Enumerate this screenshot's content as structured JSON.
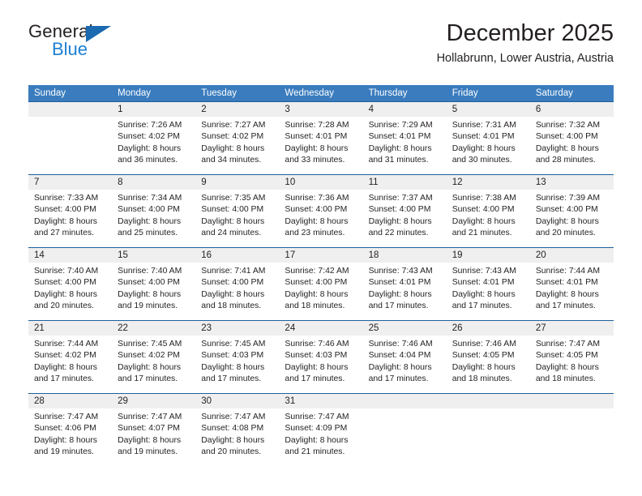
{
  "brand": {
    "name_part1": "General",
    "name_part2": "Blue",
    "triangle_color": "#1b69b0",
    "accent_color": "#1b7fd4"
  },
  "header": {
    "title": "December 2025",
    "subtitle": "Hollabrunn, Lower Austria, Austria"
  },
  "theme": {
    "header_bg": "#3a7cbe",
    "week_divider": "#1f6099",
    "daynum_bg": "#efefef",
    "text": "#231f20"
  },
  "weekdays": [
    "Sunday",
    "Monday",
    "Tuesday",
    "Wednesday",
    "Thursday",
    "Friday",
    "Saturday"
  ],
  "weeks": [
    [
      {
        "day": "",
        "sunrise": "",
        "sunset": "",
        "daylight_line1": "",
        "daylight_line2": ""
      },
      {
        "day": "1",
        "sunrise": "Sunrise: 7:26 AM",
        "sunset": "Sunset: 4:02 PM",
        "daylight_line1": "Daylight: 8 hours",
        "daylight_line2": "and 36 minutes."
      },
      {
        "day": "2",
        "sunrise": "Sunrise: 7:27 AM",
        "sunset": "Sunset: 4:02 PM",
        "daylight_line1": "Daylight: 8 hours",
        "daylight_line2": "and 34 minutes."
      },
      {
        "day": "3",
        "sunrise": "Sunrise: 7:28 AM",
        "sunset": "Sunset: 4:01 PM",
        "daylight_line1": "Daylight: 8 hours",
        "daylight_line2": "and 33 minutes."
      },
      {
        "day": "4",
        "sunrise": "Sunrise: 7:29 AM",
        "sunset": "Sunset: 4:01 PM",
        "daylight_line1": "Daylight: 8 hours",
        "daylight_line2": "and 31 minutes."
      },
      {
        "day": "5",
        "sunrise": "Sunrise: 7:31 AM",
        "sunset": "Sunset: 4:01 PM",
        "daylight_line1": "Daylight: 8 hours",
        "daylight_line2": "and 30 minutes."
      },
      {
        "day": "6",
        "sunrise": "Sunrise: 7:32 AM",
        "sunset": "Sunset: 4:00 PM",
        "daylight_line1": "Daylight: 8 hours",
        "daylight_line2": "and 28 minutes."
      }
    ],
    [
      {
        "day": "7",
        "sunrise": "Sunrise: 7:33 AM",
        "sunset": "Sunset: 4:00 PM",
        "daylight_line1": "Daylight: 8 hours",
        "daylight_line2": "and 27 minutes."
      },
      {
        "day": "8",
        "sunrise": "Sunrise: 7:34 AM",
        "sunset": "Sunset: 4:00 PM",
        "daylight_line1": "Daylight: 8 hours",
        "daylight_line2": "and 25 minutes."
      },
      {
        "day": "9",
        "sunrise": "Sunrise: 7:35 AM",
        "sunset": "Sunset: 4:00 PM",
        "daylight_line1": "Daylight: 8 hours",
        "daylight_line2": "and 24 minutes."
      },
      {
        "day": "10",
        "sunrise": "Sunrise: 7:36 AM",
        "sunset": "Sunset: 4:00 PM",
        "daylight_line1": "Daylight: 8 hours",
        "daylight_line2": "and 23 minutes."
      },
      {
        "day": "11",
        "sunrise": "Sunrise: 7:37 AM",
        "sunset": "Sunset: 4:00 PM",
        "daylight_line1": "Daylight: 8 hours",
        "daylight_line2": "and 22 minutes."
      },
      {
        "day": "12",
        "sunrise": "Sunrise: 7:38 AM",
        "sunset": "Sunset: 4:00 PM",
        "daylight_line1": "Daylight: 8 hours",
        "daylight_line2": "and 21 minutes."
      },
      {
        "day": "13",
        "sunrise": "Sunrise: 7:39 AM",
        "sunset": "Sunset: 4:00 PM",
        "daylight_line1": "Daylight: 8 hours",
        "daylight_line2": "and 20 minutes."
      }
    ],
    [
      {
        "day": "14",
        "sunrise": "Sunrise: 7:40 AM",
        "sunset": "Sunset: 4:00 PM",
        "daylight_line1": "Daylight: 8 hours",
        "daylight_line2": "and 20 minutes."
      },
      {
        "day": "15",
        "sunrise": "Sunrise: 7:40 AM",
        "sunset": "Sunset: 4:00 PM",
        "daylight_line1": "Daylight: 8 hours",
        "daylight_line2": "and 19 minutes."
      },
      {
        "day": "16",
        "sunrise": "Sunrise: 7:41 AM",
        "sunset": "Sunset: 4:00 PM",
        "daylight_line1": "Daylight: 8 hours",
        "daylight_line2": "and 18 minutes."
      },
      {
        "day": "17",
        "sunrise": "Sunrise: 7:42 AM",
        "sunset": "Sunset: 4:00 PM",
        "daylight_line1": "Daylight: 8 hours",
        "daylight_line2": "and 18 minutes."
      },
      {
        "day": "18",
        "sunrise": "Sunrise: 7:43 AM",
        "sunset": "Sunset: 4:01 PM",
        "daylight_line1": "Daylight: 8 hours",
        "daylight_line2": "and 17 minutes."
      },
      {
        "day": "19",
        "sunrise": "Sunrise: 7:43 AM",
        "sunset": "Sunset: 4:01 PM",
        "daylight_line1": "Daylight: 8 hours",
        "daylight_line2": "and 17 minutes."
      },
      {
        "day": "20",
        "sunrise": "Sunrise: 7:44 AM",
        "sunset": "Sunset: 4:01 PM",
        "daylight_line1": "Daylight: 8 hours",
        "daylight_line2": "and 17 minutes."
      }
    ],
    [
      {
        "day": "21",
        "sunrise": "Sunrise: 7:44 AM",
        "sunset": "Sunset: 4:02 PM",
        "daylight_line1": "Daylight: 8 hours",
        "daylight_line2": "and 17 minutes."
      },
      {
        "day": "22",
        "sunrise": "Sunrise: 7:45 AM",
        "sunset": "Sunset: 4:02 PM",
        "daylight_line1": "Daylight: 8 hours",
        "daylight_line2": "and 17 minutes."
      },
      {
        "day": "23",
        "sunrise": "Sunrise: 7:45 AM",
        "sunset": "Sunset: 4:03 PM",
        "daylight_line1": "Daylight: 8 hours",
        "daylight_line2": "and 17 minutes."
      },
      {
        "day": "24",
        "sunrise": "Sunrise: 7:46 AM",
        "sunset": "Sunset: 4:03 PM",
        "daylight_line1": "Daylight: 8 hours",
        "daylight_line2": "and 17 minutes."
      },
      {
        "day": "25",
        "sunrise": "Sunrise: 7:46 AM",
        "sunset": "Sunset: 4:04 PM",
        "daylight_line1": "Daylight: 8 hours",
        "daylight_line2": "and 17 minutes."
      },
      {
        "day": "26",
        "sunrise": "Sunrise: 7:46 AM",
        "sunset": "Sunset: 4:05 PM",
        "daylight_line1": "Daylight: 8 hours",
        "daylight_line2": "and 18 minutes."
      },
      {
        "day": "27",
        "sunrise": "Sunrise: 7:47 AM",
        "sunset": "Sunset: 4:05 PM",
        "daylight_line1": "Daylight: 8 hours",
        "daylight_line2": "and 18 minutes."
      }
    ],
    [
      {
        "day": "28",
        "sunrise": "Sunrise: 7:47 AM",
        "sunset": "Sunset: 4:06 PM",
        "daylight_line1": "Daylight: 8 hours",
        "daylight_line2": "and 19 minutes."
      },
      {
        "day": "29",
        "sunrise": "Sunrise: 7:47 AM",
        "sunset": "Sunset: 4:07 PM",
        "daylight_line1": "Daylight: 8 hours",
        "daylight_line2": "and 19 minutes."
      },
      {
        "day": "30",
        "sunrise": "Sunrise: 7:47 AM",
        "sunset": "Sunset: 4:08 PM",
        "daylight_line1": "Daylight: 8 hours",
        "daylight_line2": "and 20 minutes."
      },
      {
        "day": "31",
        "sunrise": "Sunrise: 7:47 AM",
        "sunset": "Sunset: 4:09 PM",
        "daylight_line1": "Daylight: 8 hours",
        "daylight_line2": "and 21 minutes."
      },
      {
        "day": "",
        "sunrise": "",
        "sunset": "",
        "daylight_line1": "",
        "daylight_line2": ""
      },
      {
        "day": "",
        "sunrise": "",
        "sunset": "",
        "daylight_line1": "",
        "daylight_line2": ""
      },
      {
        "day": "",
        "sunrise": "",
        "sunset": "",
        "daylight_line1": "",
        "daylight_line2": ""
      }
    ]
  ]
}
